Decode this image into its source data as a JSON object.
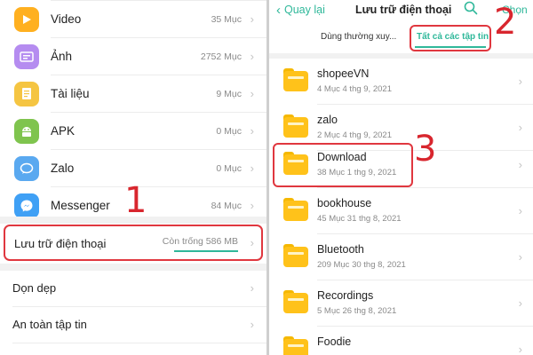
{
  "left": {
    "categories": [
      {
        "label": "Video",
        "count": "35 Mục",
        "icon": "video-icon",
        "color": "#ffb020"
      },
      {
        "label": "Ảnh",
        "count": "2752 Mục",
        "icon": "image-icon",
        "color": "#b58cf0"
      },
      {
        "label": "Tài liệu",
        "count": "9 Mục",
        "icon": "document-icon",
        "color": "#f5c542"
      },
      {
        "label": "APK",
        "count": "0 Mục",
        "icon": "android-icon",
        "color": "#7fc44e"
      },
      {
        "label": "Zalo",
        "count": "0 Mục",
        "icon": "zalo-icon",
        "color": "#5aa9f0"
      },
      {
        "label": "Messenger",
        "count": "84 Mục",
        "icon": "messenger-icon",
        "color": "#3fa0f5"
      }
    ],
    "storage": {
      "label": "Lưu trữ điện thoại",
      "free": "Còn trống 586 MB",
      "used_fraction": 0.78
    },
    "menu": [
      {
        "label": "Dọn dẹp"
      },
      {
        "label": "An toàn tập tin"
      }
    ],
    "annotation": "1"
  },
  "right": {
    "back_label": "Quay lại",
    "title": "Lưu trữ điện thoại",
    "select_label": "Chọn",
    "tabs": [
      {
        "label": "Dùng thường xuy..."
      },
      {
        "label": "Tất cả các tập tin"
      }
    ],
    "folders": [
      {
        "name": "shopeeVN",
        "meta": "4 Mục  4 thg 9, 2021"
      },
      {
        "name": "zalo",
        "meta": "2 Mục  4 thg 9, 2021"
      },
      {
        "name": "Download",
        "meta": "38 Mục  1 thg 9, 2021"
      },
      {
        "name": "bookhouse",
        "meta": "45 Mục  31 thg 8, 2021"
      },
      {
        "name": "Bluetooth",
        "meta": "209 Mục  30 thg 8, 2021"
      },
      {
        "name": "Recordings",
        "meta": "5 Mục  26 thg 8, 2021"
      },
      {
        "name": "Foodie",
        "meta": ""
      }
    ],
    "annotations": [
      "2",
      "3"
    ],
    "accent": "#2fb89a",
    "highlight": "#e0373f"
  }
}
